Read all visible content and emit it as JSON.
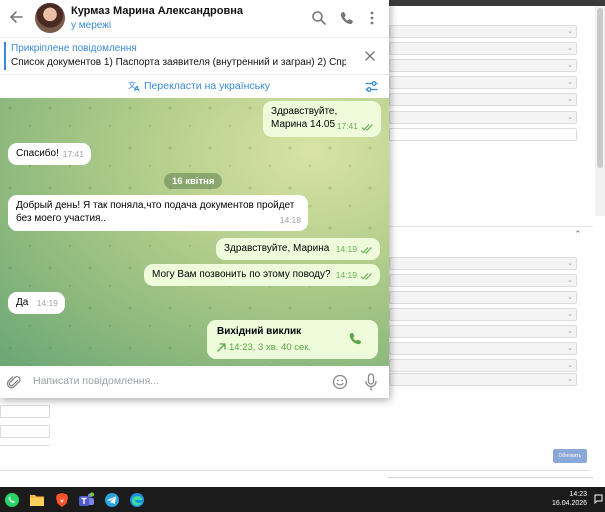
{
  "chat": {
    "contact_name": "Курмаз Марина Александровна",
    "status": "у мережі",
    "pinned": {
      "title": "Прикріплене повідомлення",
      "text": "Список документов    1) Паспорта заявителя (внутренний и загран) 2) Спр..."
    },
    "translate_label": "Перекласти на українську",
    "date_separator": "16 квітня",
    "messages": [
      {
        "side": "out",
        "text": "Здравствуйте, Марина 14.05",
        "time": "17:41",
        "read": true
      },
      {
        "side": "in",
        "text": "Спасибо!",
        "time": "17:41"
      },
      {
        "side": "in",
        "text": "Добрый день! Я так поняла,что подача документов пройдет без моего участия..",
        "time": "14:18"
      },
      {
        "side": "out",
        "text": "Здравствуйте, Марина",
        "time": "14:19",
        "read": true
      },
      {
        "side": "out",
        "text": "Могу Вам позвонить по этому поводу?",
        "time": "14:19",
        "read": true
      },
      {
        "side": "in",
        "text": "Да",
        "time": "14:19"
      }
    ],
    "call": {
      "title": "Вихідний виклик",
      "details": "14:23, 3 хв. 40 сек."
    },
    "input_placeholder": "Написати повідомлення..."
  },
  "background_app": {
    "save_button": "Обновить"
  },
  "taskbar": {
    "apps": [
      "whatsapp-icon",
      "file-explorer-icon",
      "brave-browser-icon",
      "teams-icon",
      "telegram-icon",
      "edge-icon"
    ],
    "time": "14:23",
    "date": "16.04.2026"
  },
  "colors": {
    "accent": "#3a8ad6",
    "outgoing_bubble": "#eefcdb",
    "check_marks": "#6bb05a",
    "taskbar": "#1b1b1b"
  }
}
